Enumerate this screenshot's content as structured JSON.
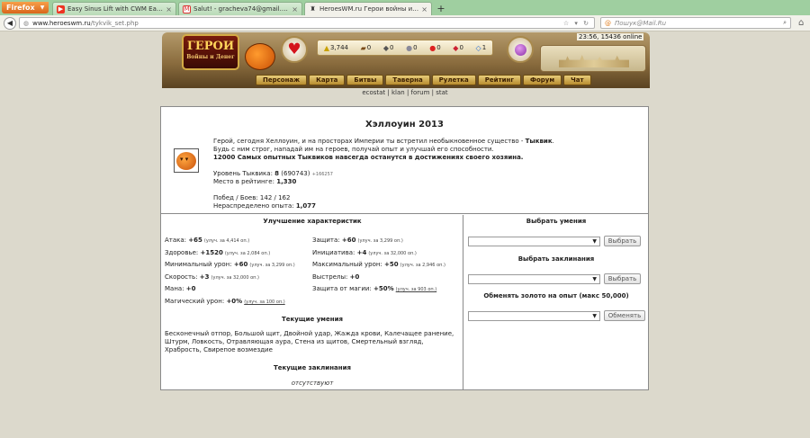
{
  "browser": {
    "menu_button": "Firefox",
    "tabs": [
      {
        "title": "Easy Sinus Lift with CWM Easy Sinus L...",
        "icon": "youtube-icon"
      },
      {
        "title": "Salut! - gracheva74@gmail.com - Gm...",
        "icon": "gmail-icon"
      },
      {
        "title": "HeroesWM.ru Герои войны и денег. ...",
        "icon": "helmet-icon",
        "active": true
      }
    ],
    "url_host": "www.heroeswm.ru",
    "url_path": "/tykvik_set.php",
    "search_placeholder": "Пошук@Mail.Ru"
  },
  "game_header": {
    "logo_text": "ГЕРОИ",
    "logo_sub": "Войны и Денег",
    "resources": [
      {
        "icon": "gold-icon",
        "value": "3,744"
      },
      {
        "icon": "wood-icon",
        "value": "0"
      },
      {
        "icon": "ore-icon",
        "value": "0"
      },
      {
        "icon": "mercury-icon",
        "value": "0"
      },
      {
        "icon": "sulfur-icon",
        "value": "0"
      },
      {
        "icon": "crystal-icon",
        "value": "0"
      },
      {
        "icon": "gem-icon",
        "value": "1"
      }
    ],
    "clock": "23:56, 15436 online",
    "menu": [
      "Персонаж",
      "Карта",
      "Битвы",
      "Таверна",
      "Рулетка",
      "Рейтинг",
      "Форум",
      "Чат"
    ],
    "sublinks": [
      "ecostat",
      "klan",
      "forum",
      "stat"
    ]
  },
  "event": {
    "title": "Хэллоуин 2013",
    "intro_line1_pre": "Герой, сегодня Хеллоуин, и на просторах Империи ты встретил необыкновенное существо - ",
    "intro_line1_bold": "Тыквик",
    "intro_line1_post": ".",
    "intro_line2": "Будь с ним строг, нападай им на героев, получай опыт и улучшай его способности.",
    "intro_line3": "12000 Самых опытных Тыквиков навсегда останутся в достижениях своего хозяина.",
    "level_label": "Уровень Тыквика:",
    "level_value": "8",
    "level_exp": "(690743)",
    "level_next": "+166257",
    "rank_label": "Место в рейтинге:",
    "rank_value": "1,330",
    "wins_label": "Побед / Боев: 142 / 162",
    "unspent_label": "Нераспределено опыта:",
    "unspent_value": "1,077"
  },
  "stats": {
    "heading": "Улучшение характеристик",
    "left": [
      {
        "label": "Атака:",
        "value": "+65",
        "up": "(улуч. за 4,414 оп.)"
      },
      {
        "label": "Здоровье:",
        "value": "+1520",
        "up": "(улуч. за 2,084 оп.)"
      },
      {
        "label": "Минимальный урон:",
        "value": "+60",
        "up": "(улуч. за 3,299 оп.)"
      },
      {
        "label": "Скорость:",
        "value": "+3",
        "up": "(улуч. за 32,000 оп.)"
      },
      {
        "label": "Мана:",
        "value": "+0",
        "up": ""
      },
      {
        "label": "Магический урон:",
        "value": "+0%",
        "up": "(улуч. за 100 оп.)"
      }
    ],
    "right": [
      {
        "label": "Защита:",
        "value": "+60",
        "up": "(улуч. за 3,299 оп.)"
      },
      {
        "label": "Инициатива:",
        "value": "+4",
        "up": "(улуч. за 32,000 оп.)"
      },
      {
        "label": "Максимальный урон:",
        "value": "+50",
        "up": "(улуч. за 2,946 оп.)"
      },
      {
        "label": "Выстрелы:",
        "value": "+0",
        "up": ""
      },
      {
        "label": "Защита от магии:",
        "value": "+50%",
        "up": "(улуч. за 903 оп.)"
      }
    ],
    "skills_heading": "Текущие умения",
    "skills_text": "Бесконечный отпор, Большой щит, Двойной удар, Жажда крови, Калечащее ранение, Штурм, Ловкость, Отравляющая аура, Стена из щитов, Смертельный взгляд, Храбрость, Свирепое возмездие",
    "spells_heading": "Текущие заклинания",
    "spells_none": "отсутствуют"
  },
  "actions": {
    "skills_heading": "Выбрать умения",
    "spells_heading": "Выбрать заклинания",
    "exchange_heading": "Обменять золото на опыт (макс 50,000)",
    "choose_button": "Выбрать",
    "exchange_button": "Обменять"
  }
}
